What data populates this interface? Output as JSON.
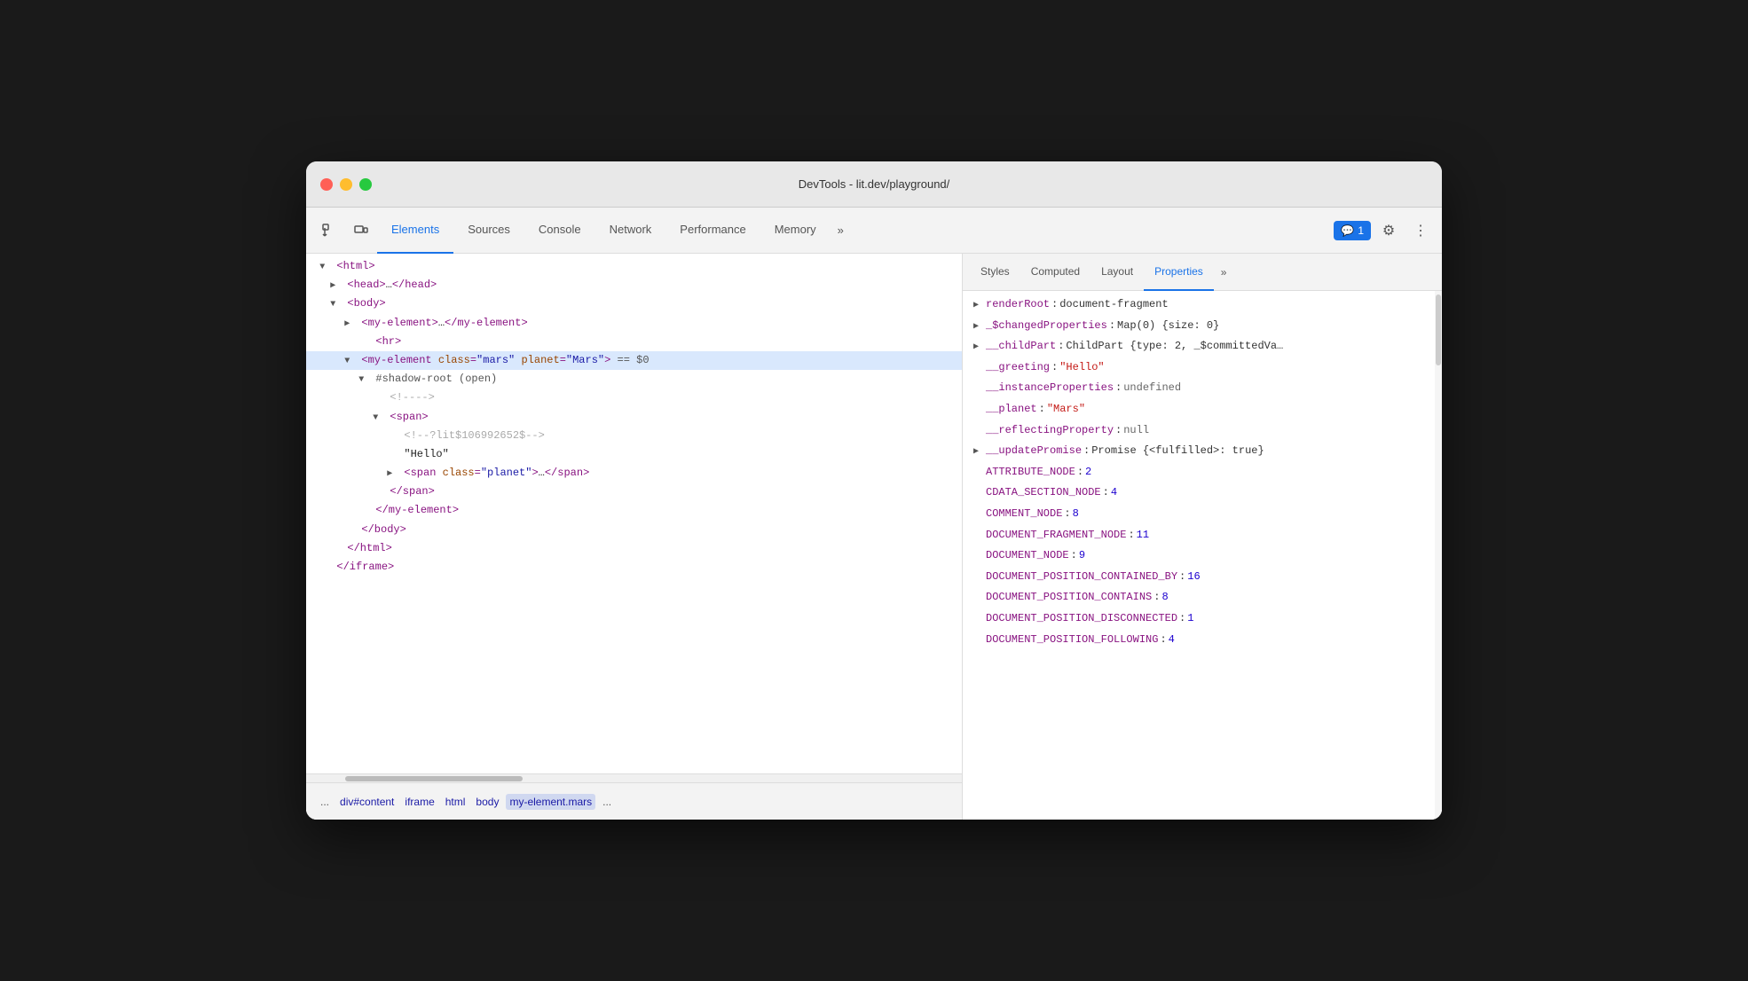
{
  "window": {
    "title": "DevTools - lit.dev/playground/"
  },
  "tabs": {
    "items": [
      {
        "label": "Elements",
        "active": true
      },
      {
        "label": "Sources"
      },
      {
        "label": "Console"
      },
      {
        "label": "Network"
      },
      {
        "label": "Performance"
      },
      {
        "label": "Memory"
      }
    ],
    "overflow": "»",
    "badge_label": "1",
    "badge_icon": "💬"
  },
  "props_tabs": {
    "items": [
      {
        "label": "Styles"
      },
      {
        "label": "Computed"
      },
      {
        "label": "Layout"
      },
      {
        "label": "Properties",
        "active": true
      }
    ],
    "overflow": "»"
  },
  "dom": {
    "lines": [
      {
        "indent": 0,
        "triangle": "open",
        "html": "<html>"
      },
      {
        "indent": 1,
        "triangle": "closed",
        "html": "<head>…</head>"
      },
      {
        "indent": 1,
        "triangle": "open",
        "html": "<body>"
      },
      {
        "indent": 2,
        "triangle": "closed",
        "html": "<my-element>…</my-element>"
      },
      {
        "indent": 2,
        "triangle": "leaf",
        "html": "<hr>"
      },
      {
        "indent": 2,
        "triangle": "open",
        "html": "<my-element class=\"mars\" planet=\"Mars\"> == $0",
        "selected": true
      },
      {
        "indent": 3,
        "triangle": "open",
        "html": "#shadow-root (open)"
      },
      {
        "indent": 4,
        "triangle": "leaf",
        "html": "<!---->"
      },
      {
        "indent": 4,
        "triangle": "open",
        "html": "<span>"
      },
      {
        "indent": 5,
        "triangle": "leaf",
        "html": "<!--?lit$106992652$-->"
      },
      {
        "indent": 5,
        "triangle": "leaf",
        "html": "\"Hello\""
      },
      {
        "indent": 5,
        "triangle": "closed",
        "html": "<span class=\"planet\">…</span>"
      },
      {
        "indent": 4,
        "triangle": "leaf",
        "html": "</span>"
      },
      {
        "indent": 3,
        "triangle": "leaf",
        "html": "</my-element>"
      },
      {
        "indent": 2,
        "triangle": "leaf",
        "html": "</body>"
      },
      {
        "indent": 1,
        "triangle": "leaf",
        "html": "</html>"
      },
      {
        "indent": 0,
        "triangle": "leaf",
        "html": "</iframe>"
      }
    ]
  },
  "breadcrumb": {
    "dots": "...",
    "items": [
      {
        "label": "div#content"
      },
      {
        "label": "iframe"
      },
      {
        "label": "html"
      },
      {
        "label": "body"
      },
      {
        "label": "my-element.mars",
        "active": true
      }
    ],
    "overflow": "..."
  },
  "properties": {
    "items": [
      {
        "indent": 0,
        "triangle": "closed",
        "key": "renderRoot",
        "colon": ":",
        "value": "document-fragment",
        "value_type": "obj"
      },
      {
        "indent": 0,
        "triangle": "closed",
        "key": "_$changedProperties",
        "colon": ":",
        "value": "Map(0) {size: 0}",
        "value_type": "obj"
      },
      {
        "indent": 0,
        "triangle": "closed",
        "key": "__childPart",
        "colon": ":",
        "value": "ChildPart {type: 2, _$committedVa…",
        "value_type": "obj"
      },
      {
        "indent": 0,
        "triangle": "leaf",
        "key": "__greeting",
        "colon": ":",
        "value": "\"Hello\"",
        "value_type": "str"
      },
      {
        "indent": 0,
        "triangle": "leaf",
        "key": "__instanceProperties",
        "colon": ":",
        "value": "undefined",
        "value_type": "gray"
      },
      {
        "indent": 0,
        "triangle": "leaf",
        "key": "__planet",
        "colon": ":",
        "value": "\"Mars\"",
        "value_type": "str"
      },
      {
        "indent": 0,
        "triangle": "leaf",
        "key": "__reflectingProperty",
        "colon": ":",
        "value": "null",
        "value_type": "gray"
      },
      {
        "indent": 0,
        "triangle": "closed",
        "key": "__updatePromise",
        "colon": ":",
        "value": "Promise {<fulfilled>: true}",
        "value_type": "obj"
      },
      {
        "indent": 0,
        "triangle": "leaf",
        "key": "ATTRIBUTE_NODE",
        "colon": ":",
        "value": "2",
        "value_type": "num"
      },
      {
        "indent": 0,
        "triangle": "leaf",
        "key": "CDATA_SECTION_NODE",
        "colon": ":",
        "value": "4",
        "value_type": "num"
      },
      {
        "indent": 0,
        "triangle": "leaf",
        "key": "COMMENT_NODE",
        "colon": ":",
        "value": "8",
        "value_type": "num"
      },
      {
        "indent": 0,
        "triangle": "leaf",
        "key": "DOCUMENT_FRAGMENT_NODE",
        "colon": ":",
        "value": "11",
        "value_type": "num"
      },
      {
        "indent": 0,
        "triangle": "leaf",
        "key": "DOCUMENT_NODE",
        "colon": ":",
        "value": "9",
        "value_type": "num"
      },
      {
        "indent": 0,
        "triangle": "leaf",
        "key": "DOCUMENT_POSITION_CONTAINED_BY",
        "colon": ":",
        "value": "16",
        "value_type": "num"
      },
      {
        "indent": 0,
        "triangle": "leaf",
        "key": "DOCUMENT_POSITION_CONTAINS",
        "colon": ":",
        "value": "8",
        "value_type": "num"
      },
      {
        "indent": 0,
        "triangle": "leaf",
        "key": "DOCUMENT_POSITION_DISCONNECTED",
        "colon": ":",
        "value": "1",
        "value_type": "num"
      },
      {
        "indent": 0,
        "triangle": "leaf",
        "key": "DOCUMENT_POSITION_FOLLOWING",
        "colon": ":",
        "value": "4",
        "value_type": "num"
      }
    ]
  }
}
